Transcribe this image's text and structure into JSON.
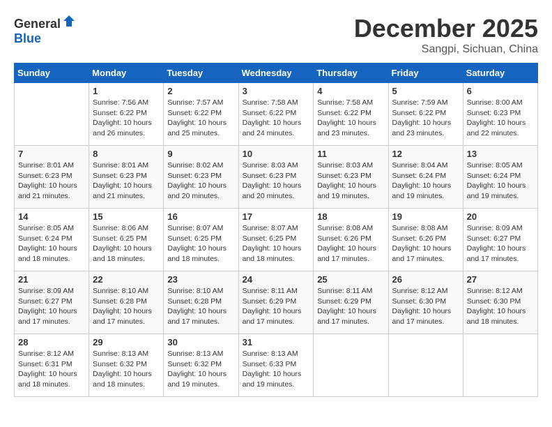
{
  "header": {
    "logo_general": "General",
    "logo_blue": "Blue",
    "month": "December 2025",
    "location": "Sangpi, Sichuan, China"
  },
  "weekdays": [
    "Sunday",
    "Monday",
    "Tuesday",
    "Wednesday",
    "Thursday",
    "Friday",
    "Saturday"
  ],
  "weeks": [
    [
      {
        "day": "",
        "info": ""
      },
      {
        "day": "1",
        "info": "Sunrise: 7:56 AM\nSunset: 6:22 PM\nDaylight: 10 hours\nand 26 minutes."
      },
      {
        "day": "2",
        "info": "Sunrise: 7:57 AM\nSunset: 6:22 PM\nDaylight: 10 hours\nand 25 minutes."
      },
      {
        "day": "3",
        "info": "Sunrise: 7:58 AM\nSunset: 6:22 PM\nDaylight: 10 hours\nand 24 minutes."
      },
      {
        "day": "4",
        "info": "Sunrise: 7:58 AM\nSunset: 6:22 PM\nDaylight: 10 hours\nand 23 minutes."
      },
      {
        "day": "5",
        "info": "Sunrise: 7:59 AM\nSunset: 6:22 PM\nDaylight: 10 hours\nand 23 minutes."
      },
      {
        "day": "6",
        "info": "Sunrise: 8:00 AM\nSunset: 6:23 PM\nDaylight: 10 hours\nand 22 minutes."
      }
    ],
    [
      {
        "day": "7",
        "info": "Sunrise: 8:01 AM\nSunset: 6:23 PM\nDaylight: 10 hours\nand 21 minutes."
      },
      {
        "day": "8",
        "info": "Sunrise: 8:01 AM\nSunset: 6:23 PM\nDaylight: 10 hours\nand 21 minutes."
      },
      {
        "day": "9",
        "info": "Sunrise: 8:02 AM\nSunset: 6:23 PM\nDaylight: 10 hours\nand 20 minutes."
      },
      {
        "day": "10",
        "info": "Sunrise: 8:03 AM\nSunset: 6:23 PM\nDaylight: 10 hours\nand 20 minutes."
      },
      {
        "day": "11",
        "info": "Sunrise: 8:03 AM\nSunset: 6:23 PM\nDaylight: 10 hours\nand 19 minutes."
      },
      {
        "day": "12",
        "info": "Sunrise: 8:04 AM\nSunset: 6:24 PM\nDaylight: 10 hours\nand 19 minutes."
      },
      {
        "day": "13",
        "info": "Sunrise: 8:05 AM\nSunset: 6:24 PM\nDaylight: 10 hours\nand 19 minutes."
      }
    ],
    [
      {
        "day": "14",
        "info": "Sunrise: 8:05 AM\nSunset: 6:24 PM\nDaylight: 10 hours\nand 18 minutes."
      },
      {
        "day": "15",
        "info": "Sunrise: 8:06 AM\nSunset: 6:25 PM\nDaylight: 10 hours\nand 18 minutes."
      },
      {
        "day": "16",
        "info": "Sunrise: 8:07 AM\nSunset: 6:25 PM\nDaylight: 10 hours\nand 18 minutes."
      },
      {
        "day": "17",
        "info": "Sunrise: 8:07 AM\nSunset: 6:25 PM\nDaylight: 10 hours\nand 18 minutes."
      },
      {
        "day": "18",
        "info": "Sunrise: 8:08 AM\nSunset: 6:26 PM\nDaylight: 10 hours\nand 17 minutes."
      },
      {
        "day": "19",
        "info": "Sunrise: 8:08 AM\nSunset: 6:26 PM\nDaylight: 10 hours\nand 17 minutes."
      },
      {
        "day": "20",
        "info": "Sunrise: 8:09 AM\nSunset: 6:27 PM\nDaylight: 10 hours\nand 17 minutes."
      }
    ],
    [
      {
        "day": "21",
        "info": "Sunrise: 8:09 AM\nSunset: 6:27 PM\nDaylight: 10 hours\nand 17 minutes."
      },
      {
        "day": "22",
        "info": "Sunrise: 8:10 AM\nSunset: 6:28 PM\nDaylight: 10 hours\nand 17 minutes."
      },
      {
        "day": "23",
        "info": "Sunrise: 8:10 AM\nSunset: 6:28 PM\nDaylight: 10 hours\nand 17 minutes."
      },
      {
        "day": "24",
        "info": "Sunrise: 8:11 AM\nSunset: 6:29 PM\nDaylight: 10 hours\nand 17 minutes."
      },
      {
        "day": "25",
        "info": "Sunrise: 8:11 AM\nSunset: 6:29 PM\nDaylight: 10 hours\nand 17 minutes."
      },
      {
        "day": "26",
        "info": "Sunrise: 8:12 AM\nSunset: 6:30 PM\nDaylight: 10 hours\nand 17 minutes."
      },
      {
        "day": "27",
        "info": "Sunrise: 8:12 AM\nSunset: 6:30 PM\nDaylight: 10 hours\nand 18 minutes."
      }
    ],
    [
      {
        "day": "28",
        "info": "Sunrise: 8:12 AM\nSunset: 6:31 PM\nDaylight: 10 hours\nand 18 minutes."
      },
      {
        "day": "29",
        "info": "Sunrise: 8:13 AM\nSunset: 6:32 PM\nDaylight: 10 hours\nand 18 minutes."
      },
      {
        "day": "30",
        "info": "Sunrise: 8:13 AM\nSunset: 6:32 PM\nDaylight: 10 hours\nand 19 minutes."
      },
      {
        "day": "31",
        "info": "Sunrise: 8:13 AM\nSunset: 6:33 PM\nDaylight: 10 hours\nand 19 minutes."
      },
      {
        "day": "",
        "info": ""
      },
      {
        "day": "",
        "info": ""
      },
      {
        "day": "",
        "info": ""
      }
    ]
  ]
}
